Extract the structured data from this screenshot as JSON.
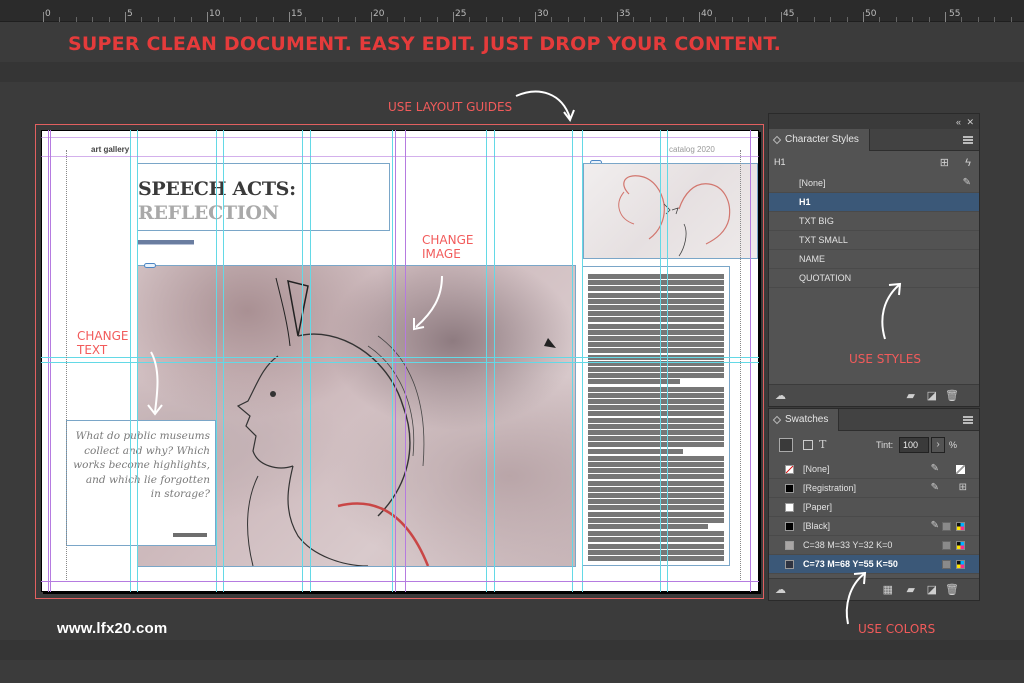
{
  "ruler": {
    "labels": [
      "0",
      "5",
      "10",
      "15",
      "20",
      "25",
      "30",
      "35",
      "40",
      "45",
      "50",
      "55"
    ]
  },
  "headline": "SUPER CLEAN DOCUMENT. EASY EDIT. JUST DROP YOUR CONTENT.",
  "annotations": {
    "layout_guides": "USE LAYOUT GUIDES",
    "change_image": [
      "CHANGE",
      "IMAGE"
    ],
    "change_text": [
      "CHANGE",
      "TEXT"
    ],
    "use_styles": "USE STYLES",
    "use_colors": "USE COLORS"
  },
  "document": {
    "running_left": "art gallery",
    "running_right": "catalog 2020",
    "title_line1": "SPEECH ACTS:",
    "title_line2": "REFLECTION",
    "quote": "What do public museums collect and why? Which works become highlights, and which lie forgotten in storage?"
  },
  "character_styles": {
    "title": "Character Styles",
    "current": "H1",
    "items": [
      "[None]",
      "H1",
      "TXT BIG",
      "TXT SMALL",
      "NAME",
      "QUOTATION"
    ],
    "selected_index": 1
  },
  "swatches": {
    "title": "Swatches",
    "tint_label": "Tint:",
    "tint_value": "100",
    "tint_unit": "%",
    "items": [
      {
        "name": "[None]",
        "color": "none"
      },
      {
        "name": "[Registration]",
        "color": "#000000"
      },
      {
        "name": "[Paper]",
        "color": "#ffffff"
      },
      {
        "name": "[Black]",
        "color": "#000000"
      },
      {
        "name": "C=38 M=33 Y=32 K=0",
        "color": "#a9a6a5"
      },
      {
        "name": "C=73 M=68 Y=55 K=50",
        "color": "#2e3340"
      }
    ],
    "selected_index": 5
  },
  "footer": {
    "website": "www.lfx20.com"
  },
  "colors": {
    "accent_red": "#e53b3b",
    "selection_blue": "#3b5878",
    "guide_cyan": "#63d9e6",
    "guide_purple": "#b57be0"
  }
}
